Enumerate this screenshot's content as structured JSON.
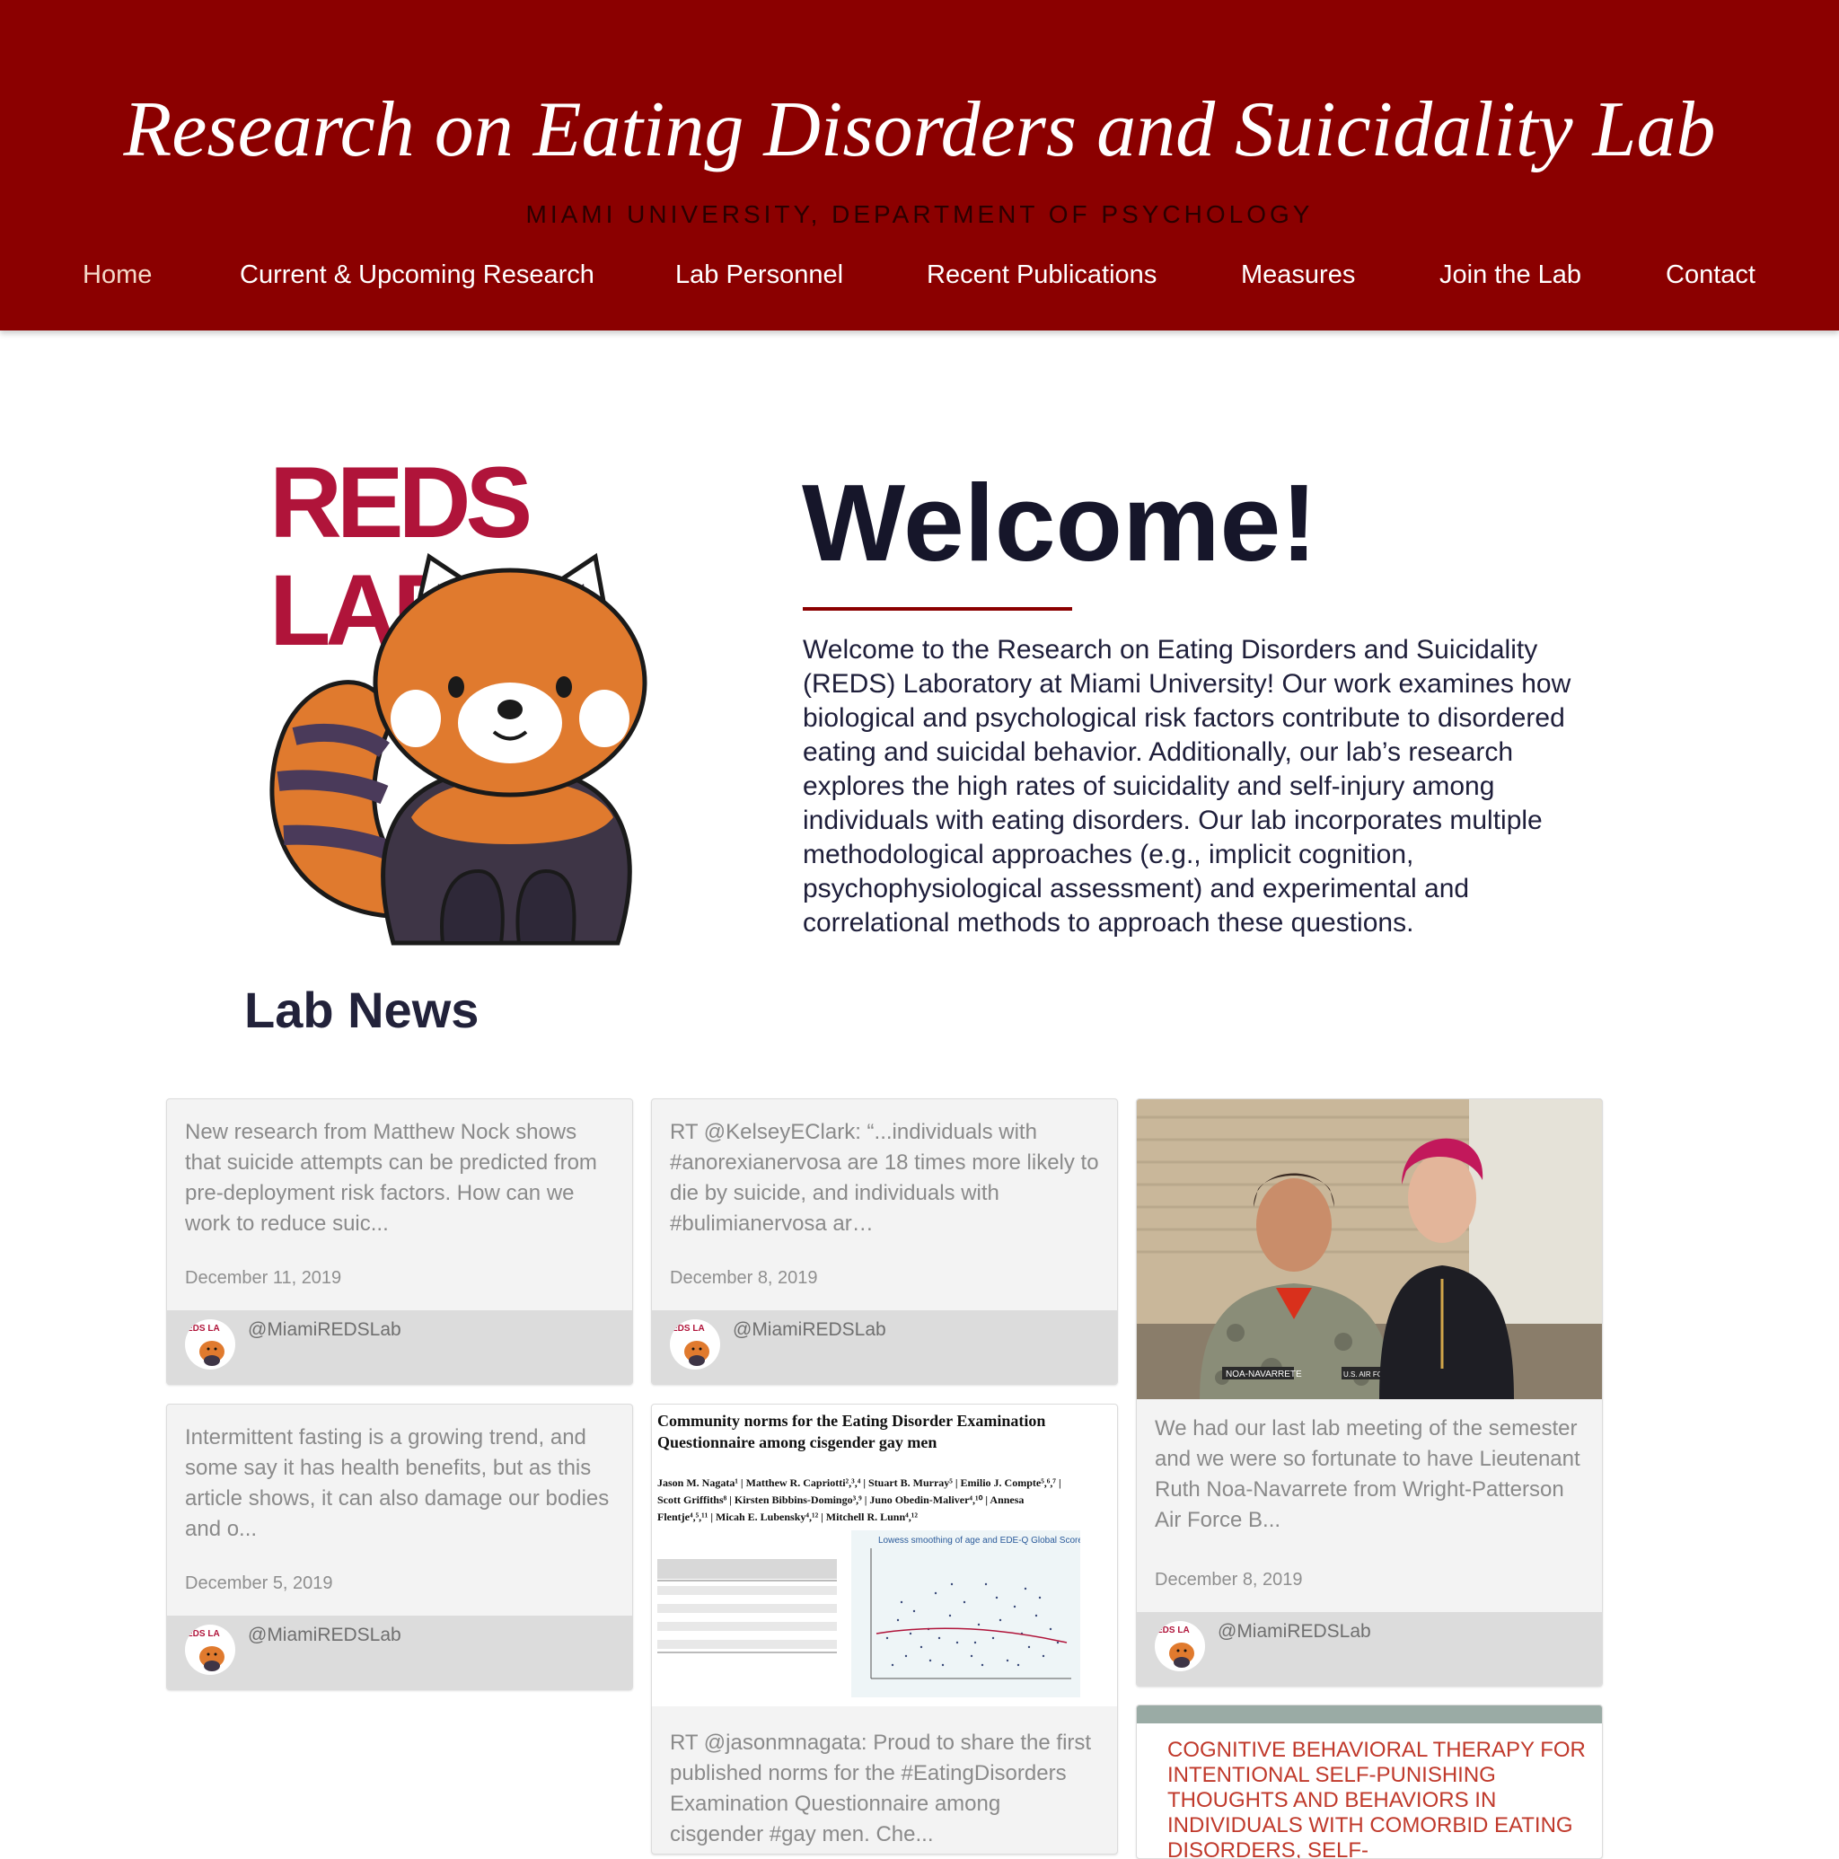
{
  "header": {
    "title": "Research on Eating Disorders and Suicidality Lab",
    "subtitle": "MIAMI UNIVERSITY, DEPARTMENT OF PSYCHOLOGY",
    "nav": [
      {
        "label": "Home",
        "active": true
      },
      {
        "label": "Current & Upcoming Research"
      },
      {
        "label": "Lab Personnel"
      },
      {
        "label": "Recent Publications"
      },
      {
        "label": "Measures"
      },
      {
        "label": "Join the Lab"
      },
      {
        "label": "Contact"
      }
    ]
  },
  "hero": {
    "logo_text": "REDS LAB",
    "heading": "Welcome!",
    "body": "Welcome to the Research on Eating Disorders and Suicidality (REDS) Laboratory at Miami University! Our work examines how biological and psychological risk factors contribute to disordered eating and suicidal behavior. Additionally, our lab’s research explores the high rates of suicidality and self-injury among individuals with eating disorders. Our lab incorporates multiple methodological approaches (e.g., implicit cognition, psychophysiological assessment) and experimental and correlational methods to approach these questions."
  },
  "news": {
    "heading": "Lab News",
    "handle": "@MiamiREDSLab",
    "avatar_text": "EDS LA",
    "cards": [
      {
        "text": "New research from Matthew Nock shows that suicide attempts can be predicted from pre-deployment risk factors. How can we work to reduce suic...",
        "date": "December 11, 2019"
      },
      {
        "text": "RT @KelseyEClark: “...individuals with #anorexianervosa are 18 times more likely to die by suicide, and individuals with #bulimianervosa ar…",
        "date": "December 8, 2019"
      },
      {
        "text": "We had our last lab meeting of the semester and we were so fortunate to have Lieutenant Ruth Noa-Navarrete from Wright-Patterson Air Force B...",
        "date": "December 8, 2019",
        "photo_name_tag": "NOA-NAVARRETE",
        "photo_service_tag": "U.S. AIR FORCE"
      },
      {
        "text": "Intermittent fasting is a growing trend, and some say it has health benefits, but as this article shows, it can also damage our bodies and o...",
        "date": "December 5, 2019"
      },
      {
        "paper_title": "Community norms for the Eating Disorder Examination Questionnaire among cisgender gay men",
        "paper_authors": "Jason M. Nagata¹ | Matthew R. Capriotti²,³,⁴ | Stuart B. Murray⁵ | Emilio J. Compte⁵,⁶,⁷ | Scott Griffiths⁸ | Kirsten Bibbins-Domingo³,⁹ | Juno Obedin-Maliver⁴,¹⁰ | Annesa Flentje⁴,⁵,¹¹ | Micah E. Lubensky⁴,¹² | Mitchell R. Lunn⁴,¹²",
        "paper_chart_title": "Lowess smoothing of age and EDE-Q Global Score",
        "text": "RT @jasonmnagata: Proud to share the first published norms for the #EatingDisorders Examination Questionnaire among cisgender #gay men. Che..."
      },
      {
        "article_title": "COGNITIVE BEHAVIORAL THERAPY FOR INTENTIONAL SELF-PUNISHING THOUGHTS AND BEHAVIORS IN INDIVIDUALS WITH COMORBID EATING DISORDERS, SELF-"
      }
    ]
  },
  "colors": {
    "header_bg": "#8b0000",
    "logo_red": "#b0143a",
    "heading_dark": "#16162a",
    "card_bg": "#f3f3f3",
    "card_footer": "#dcdcdc",
    "article_red": "#c0392b"
  },
  "icons": {
    "logo": "red-panda-logo",
    "avatar": "reds-lab-avatar"
  }
}
